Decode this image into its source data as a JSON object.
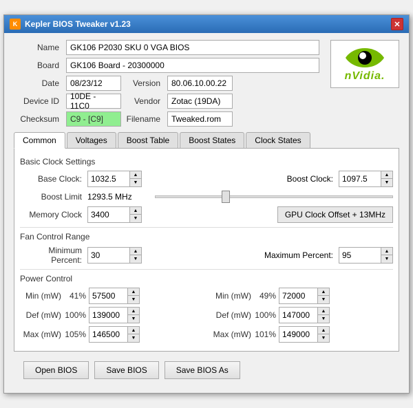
{
  "window": {
    "title": "Kepler BIOS Tweaker v1.23",
    "close_label": "✕"
  },
  "header": {
    "name_label": "Name",
    "name_value": "GK106 P2030 SKU 0 VGA BIOS",
    "board_label": "Board",
    "board_value": "GK106 Board - 20300000",
    "date_label": "Date",
    "date_value": "08/23/12",
    "version_label": "Version",
    "version_value": "80.06.10.00.22",
    "device_id_label": "Device ID",
    "device_id_value": "10DE - 11C0",
    "vendor_label": "Vendor",
    "vendor_value": "Zotac (19DA)",
    "checksum_label": "Checksum",
    "checksum_value": "C9 - [C9]",
    "filename_label": "Filename",
    "filename_value": "Tweaked.rom"
  },
  "tabs": {
    "items": [
      "Common",
      "Voltages",
      "Boost Table",
      "Boost States",
      "Clock States"
    ],
    "active": "Common"
  },
  "common": {
    "basic_clock_title": "Basic Clock Settings",
    "base_clock_label": "Base Clock:",
    "base_clock_value": "1032.5",
    "boost_clock_label": "Boost Clock:",
    "boost_clock_value": "1097.5",
    "boost_limit_label": "Boost Limit",
    "boost_limit_value": "1293.5 MHz",
    "memory_clock_label": "Memory Clock",
    "memory_clock_value": "3400",
    "gpu_offset_label": "GPU Clock Offset + 13MHz",
    "fan_control_title": "Fan Control Range",
    "min_percent_label": "Minimum Percent:",
    "min_percent_value": "30",
    "max_percent_label": "Maximum Percent:",
    "max_percent_value": "95",
    "power_control_title": "Power Control",
    "left_min_mw_label": "Min (mW)",
    "left_min_pct": "41%",
    "left_min_val": "57500",
    "left_def_mw_label": "Def (mW)",
    "left_def_pct": "100%",
    "left_def_val": "139000",
    "left_max_mw_label": "Max (mW)",
    "left_max_pct": "105%",
    "left_max_val": "146500",
    "right_min_mw_label": "Min (mW)",
    "right_min_pct": "49%",
    "right_min_val": "72000",
    "right_def_mw_label": "Def (mW)",
    "right_def_pct": "100%",
    "right_def_val": "147000",
    "right_max_mw_label": "Max (mW)",
    "right_max_pct": "101%",
    "right_max_val": "149000"
  },
  "footer": {
    "open_bios": "Open BIOS",
    "save_bios": "Save BIOS",
    "save_bios_as": "Save BIOS As"
  }
}
